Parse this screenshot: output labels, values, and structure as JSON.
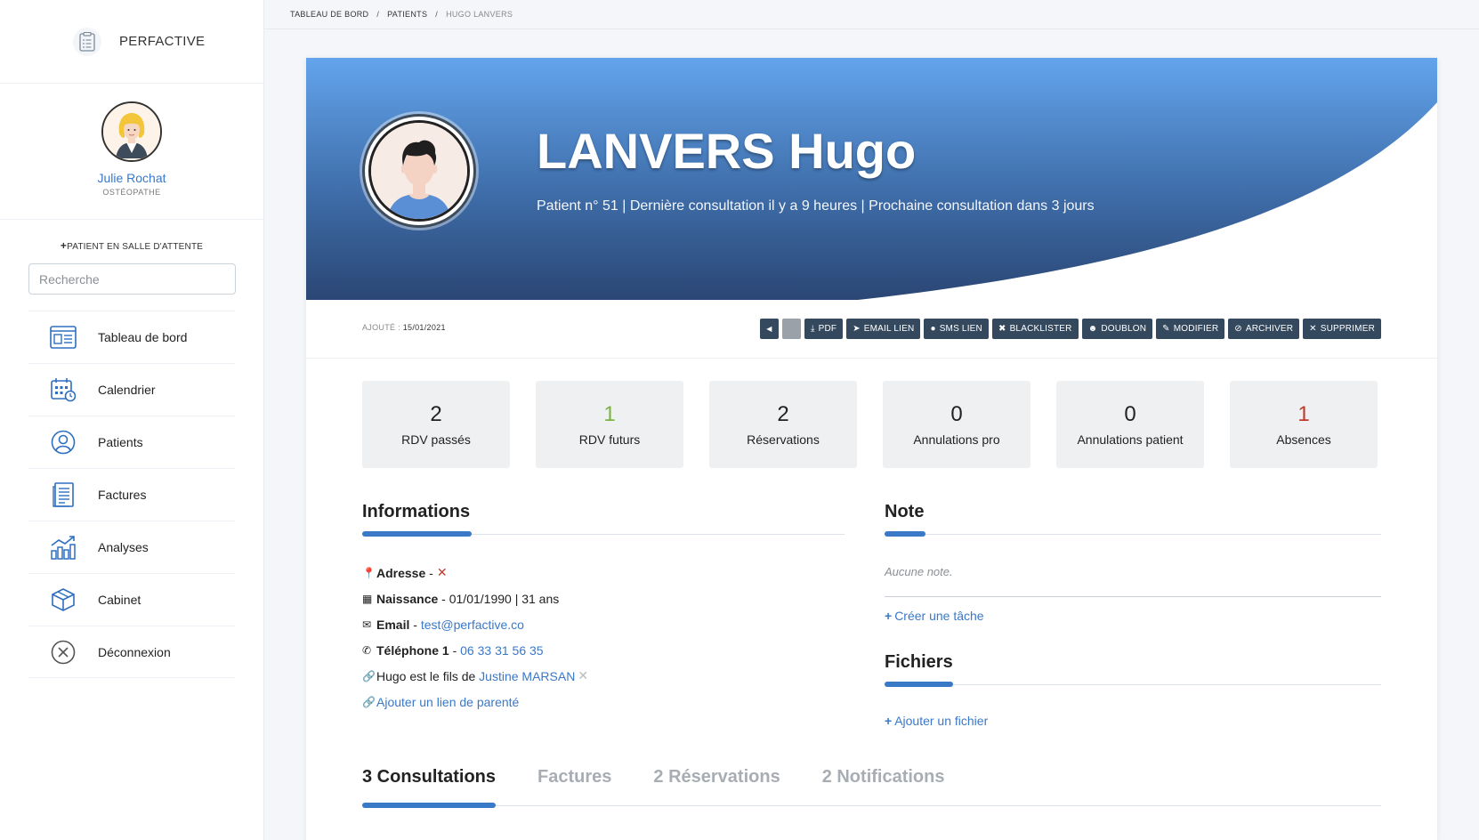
{
  "brand": {
    "name": "PERFACTIVE",
    "icon": "clipboard-list-icon"
  },
  "user": {
    "name": "Julie Rochat",
    "role": "OSTÉOPATHE"
  },
  "sidebar": {
    "waiting_room_label": "PATIENT EN SALLE D'ATTENTE",
    "search_placeholder": "Recherche",
    "items": [
      {
        "label": "Tableau de bord",
        "icon": "dashboard-icon"
      },
      {
        "label": "Calendrier",
        "icon": "calendar-icon"
      },
      {
        "label": "Patients",
        "icon": "user-circle-icon"
      },
      {
        "label": "Factures",
        "icon": "invoice-icon"
      },
      {
        "label": "Analyses",
        "icon": "chart-icon"
      },
      {
        "label": "Cabinet",
        "icon": "box-icon"
      },
      {
        "label": "Déconnexion",
        "icon": "logout-icon"
      }
    ]
  },
  "breadcrumb": [
    "TABLEAU DE BORD",
    "PATIENTS",
    "HUGO LANVERS"
  ],
  "patient": {
    "name": "LANVERS Hugo",
    "subtitle": "Patient n° 51 | Dernière consultation il y a 9 heures | Prochaine consultation dans 3 jours",
    "added_label": "AJOUTÉ : ",
    "added_date": "15/01/2021"
  },
  "actions": [
    {
      "label": "PDF",
      "icon": "download-icon"
    },
    {
      "label": "EMAIL LIEN",
      "icon": "send-icon"
    },
    {
      "label": "SMS LIEN",
      "icon": "comment-icon"
    },
    {
      "label": "BLACKLISTER",
      "icon": "user-block-icon"
    },
    {
      "label": "DOUBLON",
      "icon": "users-icon"
    },
    {
      "label": "MODIFIER",
      "icon": "pencil-icon"
    },
    {
      "label": "ARCHIVER",
      "icon": "archive-user-icon"
    },
    {
      "label": "SUPPRIMER",
      "icon": "close-icon"
    }
  ],
  "stats": [
    {
      "value": "2",
      "label": "RDV passés",
      "color": "#222222"
    },
    {
      "value": "1",
      "label": "RDV futurs",
      "color": "#7cb342"
    },
    {
      "value": "2",
      "label": "Réservations",
      "color": "#222222"
    },
    {
      "value": "0",
      "label": "Annulations pro",
      "color": "#222222"
    },
    {
      "value": "0",
      "label": "Annulations patient",
      "color": "#222222"
    },
    {
      "value": "1",
      "label": "Absences",
      "color": "#c0392b"
    }
  ],
  "informations": {
    "title": "Informations",
    "address_label": "Adresse",
    "birth_label": "Naissance",
    "birth_value": "01/01/1990 | 31 ans",
    "email_label": "Email",
    "email_value": "test@perfactive.co",
    "phone_label": "Téléphone 1",
    "phone_value": "06 33 31 56 35",
    "relation_prefix": "Hugo est le fils de ",
    "relation_name": "Justine MARSAN",
    "add_relation": "Ajouter un lien de parenté"
  },
  "note": {
    "title": "Note",
    "empty": "Aucune note.",
    "create_task": "Créer une tâche"
  },
  "files": {
    "title": "Fichiers",
    "add_file": "Ajouter un fichier"
  },
  "tabs": [
    "3 Consultations",
    "Factures",
    "2 Réservations",
    "2 Notifications"
  ],
  "colors": {
    "accent": "#3a78c8",
    "dark_button": "#34495e",
    "hero_top": "#5e9ee8",
    "hero_bottom": "#2c4a7a"
  }
}
